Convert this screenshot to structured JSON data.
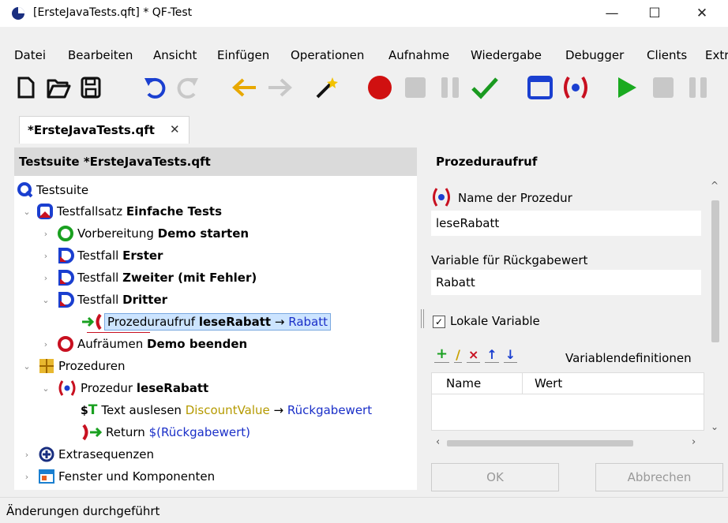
{
  "window": {
    "title": "[ErsteJavaTests.qft] * QF-Test"
  },
  "menu": [
    "Datei",
    "Bearbeiten",
    "Ansicht",
    "Einfügen",
    "Operationen",
    "Aufnahme",
    "Wiedergabe",
    "Debugger",
    "Clients",
    "Extr"
  ],
  "tab": {
    "label": "*ErsteJavaTests.qft",
    "close": "✕"
  },
  "tree": {
    "header": "Testsuite *ErsteJavaTests.qft",
    "items": [
      {
        "type": "Testsuite",
        "name": ""
      },
      {
        "type": "Testfallsatz",
        "name": "Einfache Tests"
      },
      {
        "type": "Vorbereitung",
        "name": "Demo starten"
      },
      {
        "type": "Testfall",
        "name": "Erster"
      },
      {
        "type": "Testfall",
        "name": "Zweiter (mit Fehler)"
      },
      {
        "type": "Testfall",
        "name": "Dritter"
      },
      {
        "type": "Prozeduraufruf",
        "name": "leseRabatt",
        "arrow": "→",
        "target": "Rabatt"
      },
      {
        "type": "Aufräumen",
        "name": "Demo beenden"
      },
      {
        "type": "Prozeduren",
        "name": ""
      },
      {
        "type": "Prozedur",
        "name": "leseRabatt"
      },
      {
        "type": "Text auslesen",
        "name": "DiscountValue",
        "arrow": "→",
        "target": "Rückgabewert"
      },
      {
        "type": "Return",
        "name": "$(Rückgabewert)"
      },
      {
        "type": "Extrasequenzen",
        "name": ""
      },
      {
        "type": "Fenster und Komponenten",
        "name": ""
      }
    ]
  },
  "details": {
    "title": "Prozeduraufruf",
    "name_label": "Name der Prozedur",
    "name_value": "leseRabatt",
    "var_label": "Variable für Rückgabewert",
    "var_value": "Rabatt",
    "local_var_label": "Lokale Variable",
    "local_var_checked": true,
    "vardefs_label": "Variablendefinitionen",
    "col_name": "Name",
    "col_value": "Wert",
    "ok": "OK",
    "cancel": "Abbrechen"
  },
  "status": "Änderungen durchgeführt"
}
